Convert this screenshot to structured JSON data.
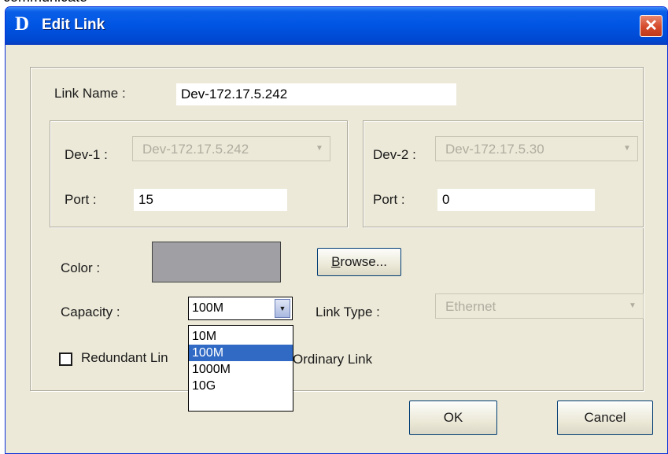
{
  "top_fragment": "communicate",
  "window": {
    "logo": "D",
    "title": "Edit Link",
    "close_glyph": "✕"
  },
  "form": {
    "link_name_label": "Link Name :",
    "link_name_value": "Dev-172.17.5.242",
    "dev1": {
      "label": "Dev-1 :",
      "value": "Dev-172.17.5.242",
      "enabled": false,
      "port_label": "Port :",
      "port_value": "15"
    },
    "dev2": {
      "label": "Dev-2 :",
      "value": "Dev-172.17.5.30",
      "enabled": false,
      "port_label": "Port :",
      "port_value": "0"
    },
    "color_label": "Color :",
    "color_value": "#a0a0a4",
    "browse_label": "Browse...",
    "capacity_label": "Capacity :",
    "capacity_value": "100M",
    "capacity_options": [
      "10M",
      "100M",
      "1000M",
      "10G"
    ],
    "capacity_selected_index": 1,
    "link_type_label": "Link Type :",
    "link_type_value": "Ethernet",
    "link_type_enabled": false,
    "redundant_label": "Redundant Lin",
    "redundant_checked": false,
    "ordinary_label": "Ordinary Link"
  },
  "buttons": {
    "ok": "OK",
    "cancel": "Cancel"
  },
  "icons": {
    "dropdown_arrow": "▼",
    "close": "close-icon"
  }
}
